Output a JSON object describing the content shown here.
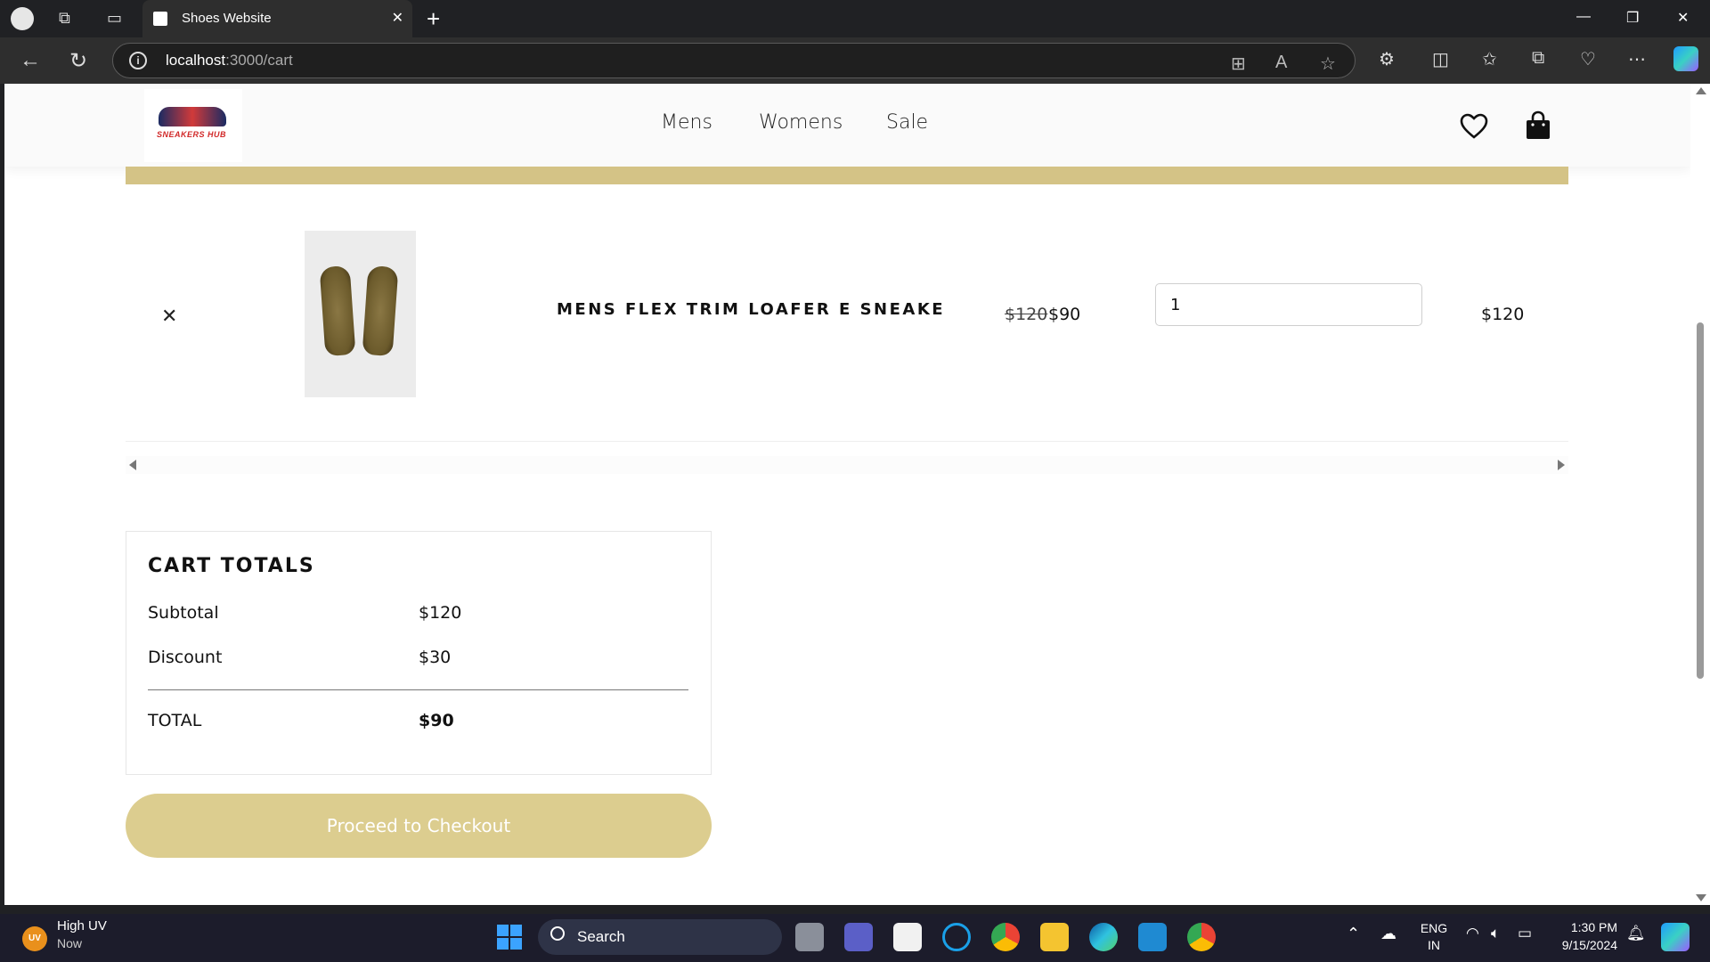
{
  "browser": {
    "tab_title": "Shoes Website",
    "url_host": "localhost",
    "url_path": ":3000/cart"
  },
  "site": {
    "logo_text": "SNEAKERS HUB",
    "nav": [
      "Mens",
      "Womens",
      "Sale"
    ]
  },
  "cart": {
    "item": {
      "name": "MENS FLEX TRIM LOAFER E SNEAKE",
      "price_original": "$120",
      "price_sale": "$90",
      "quantity": "1",
      "line_total": "$120"
    }
  },
  "totals": {
    "title": "CART TOTALS",
    "subtotal_label": "Subtotal",
    "subtotal_value": "$120",
    "discount_label": "Discount",
    "discount_value": "$30",
    "total_label": "TOTAL",
    "total_value": "$90",
    "checkout_label": "Proceed to Checkout"
  },
  "taskbar": {
    "weather_title": "High UV",
    "weather_sub": "Now",
    "weather_badge": "UV",
    "search_label": "Search",
    "lang_top": "ENG",
    "lang_bottom": "IN",
    "time": "1:30 PM",
    "date": "9/15/2024"
  },
  "colors": {
    "accent_gold": "#d4c386",
    "button_gold": "#dccd8f"
  }
}
